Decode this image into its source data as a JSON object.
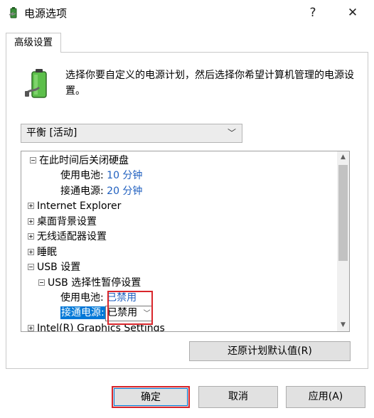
{
  "window": {
    "title": "电源选项",
    "help": "?",
    "close": "✕"
  },
  "tab": {
    "label": "高级设置"
  },
  "description": "选择你要自定义的电源计划，然后选择你希望计算机管理的电源设置。",
  "plan_select": {
    "value": "平衡 [活动]",
    "chevron": "﹀"
  },
  "tree": {
    "hdd_header": "在此时间后关闭硬盘",
    "hdd_battery_label": "使用电池:",
    "hdd_battery_value": "10 分钟",
    "hdd_plugged_label": "接通电源:",
    "hdd_plugged_value": "20 分钟",
    "ie": "Internet Explorer",
    "desktop_bg": "桌面背景设置",
    "wireless": "无线适配器设置",
    "sleep": "睡眠",
    "usb": "USB 设置",
    "usb_suspend": "USB 选择性暂停设置",
    "usb_battery_label": "使用电池:",
    "usb_battery_value": "已禁用",
    "usb_plugged_label": "接通电源:",
    "usb_plugged_value": "已禁用",
    "intel": "Intel(R) Graphics Settings"
  },
  "buttons": {
    "restore": "还原计划默认值(R)",
    "ok": "确定",
    "cancel": "取消",
    "apply": "应用(A)"
  },
  "colors": {
    "accent": "#0078d7",
    "highlight_box": "#d9262b",
    "value_text": "#1f5fbf"
  }
}
